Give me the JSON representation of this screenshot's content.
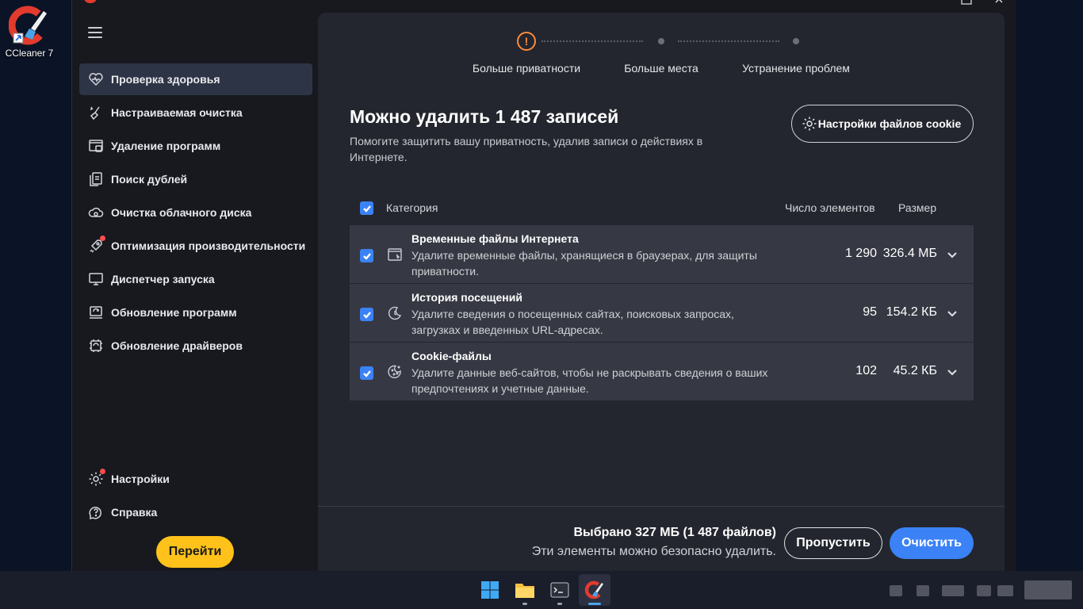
{
  "desktop": {
    "shortcut_label": "CCleaner 7"
  },
  "sidebar": {
    "items": [
      {
        "label": "Проверка здоровья",
        "icon": "heart-icon",
        "active": true
      },
      {
        "label": "Настраиваемая очистка",
        "icon": "broom-sparkle-icon"
      },
      {
        "label": "Удаление программ",
        "icon": "uninstall-icon"
      },
      {
        "label": "Поиск дублей",
        "icon": "duplicate-files-icon"
      },
      {
        "label": "Очистка облачного диска",
        "icon": "cloud-gear-icon"
      },
      {
        "label": "Оптимизация производительности",
        "icon": "rocket-icon"
      },
      {
        "label": "Диспетчер запуска",
        "icon": "monitor-icon"
      },
      {
        "label": "Обновление программ",
        "icon": "software-update-icon"
      },
      {
        "label": "Обновление драйверов",
        "icon": "driver-update-icon"
      }
    ],
    "bottom": [
      {
        "label": "Настройки",
        "icon": "gear-icon"
      },
      {
        "label": "Справка",
        "icon": "help-icon"
      }
    ],
    "go_button": "Перейти"
  },
  "stepper": {
    "steps": [
      {
        "label": "Больше приватности",
        "state": "warning"
      },
      {
        "label": "Больше места",
        "state": "pending"
      },
      {
        "label": "Устранение проблем",
        "state": "pending"
      }
    ],
    "warning_glyph": "!"
  },
  "main": {
    "title": "Можно удалить 1 487 записей",
    "subtitle": "Помогите защитить вашу приватность, удалив записи о действиях в Интернете.",
    "cookie_button": "Настройки файлов cookie"
  },
  "table": {
    "headers": {
      "category": "Категория",
      "count": "Число элементов",
      "size": "Размер"
    },
    "rows": [
      {
        "title": "Временные файлы Интернета",
        "desc": "Удалите временные файлы, хранящиеся в браузерах, для защиты приватности.",
        "count": "1 290",
        "size": "326.4 МБ",
        "icon": "browser-window-icon",
        "checked": true
      },
      {
        "title": "История посещений",
        "desc": "Удалите сведения о посещенных сайтах, поисковых запросах, загрузках и введенных URL-адресах.",
        "count": "95",
        "size": "154.2 КБ",
        "icon": "history-icon",
        "checked": true
      },
      {
        "title": "Cookie-файлы",
        "desc": "Удалите данные веб-сайтов, чтобы не раскрывать сведения о ваших предпочтениях и учетные данные.",
        "count": "102",
        "size": "45.2 КБ",
        "icon": "cookie-icon",
        "checked": true
      }
    ]
  },
  "footer": {
    "selected": "Выбрано 327 МБ (1 487 файлов)",
    "safe": "Эти элементы можно безопасно удалить.",
    "skip": "Пропустить",
    "clean": "Очистить"
  },
  "colors": {
    "accent": "#3b82f6",
    "go": "#ffc21a",
    "warning": "#ff8a3d",
    "badge": "#ff4b4b"
  }
}
